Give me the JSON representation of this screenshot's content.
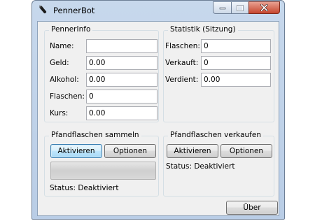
{
  "window": {
    "title": "PennerBot",
    "icon": "bottle-icon"
  },
  "penner_info": {
    "legend": "PennerInfo",
    "fields": [
      {
        "label": "Name:",
        "value": ""
      },
      {
        "label": "Geld:",
        "value": "0.00"
      },
      {
        "label": "Alkohol:",
        "value": "0.00"
      },
      {
        "label": "Flaschen:",
        "value": "0"
      },
      {
        "label": "Kurs:",
        "value": "0.00"
      }
    ]
  },
  "statistik": {
    "legend": "Statistik (Sitzung)",
    "fields": [
      {
        "label": "Flaschen:",
        "value": "0"
      },
      {
        "label": "Verkauft:",
        "value": "0"
      },
      {
        "label": "Verdient:",
        "value": "0.00"
      }
    ]
  },
  "sammeln": {
    "legend": "Pfandflaschen sammeln",
    "activate_label": "Aktivieren",
    "options_label": "Optionen",
    "progress": 0,
    "status": "Status: Deaktiviert"
  },
  "verkaufen": {
    "legend": "Pfandflaschen verkaufen",
    "activate_label": "Aktivieren",
    "options_label": "Optionen",
    "status": "Status: Deaktiviert"
  },
  "footer": {
    "about_label": "Über"
  }
}
